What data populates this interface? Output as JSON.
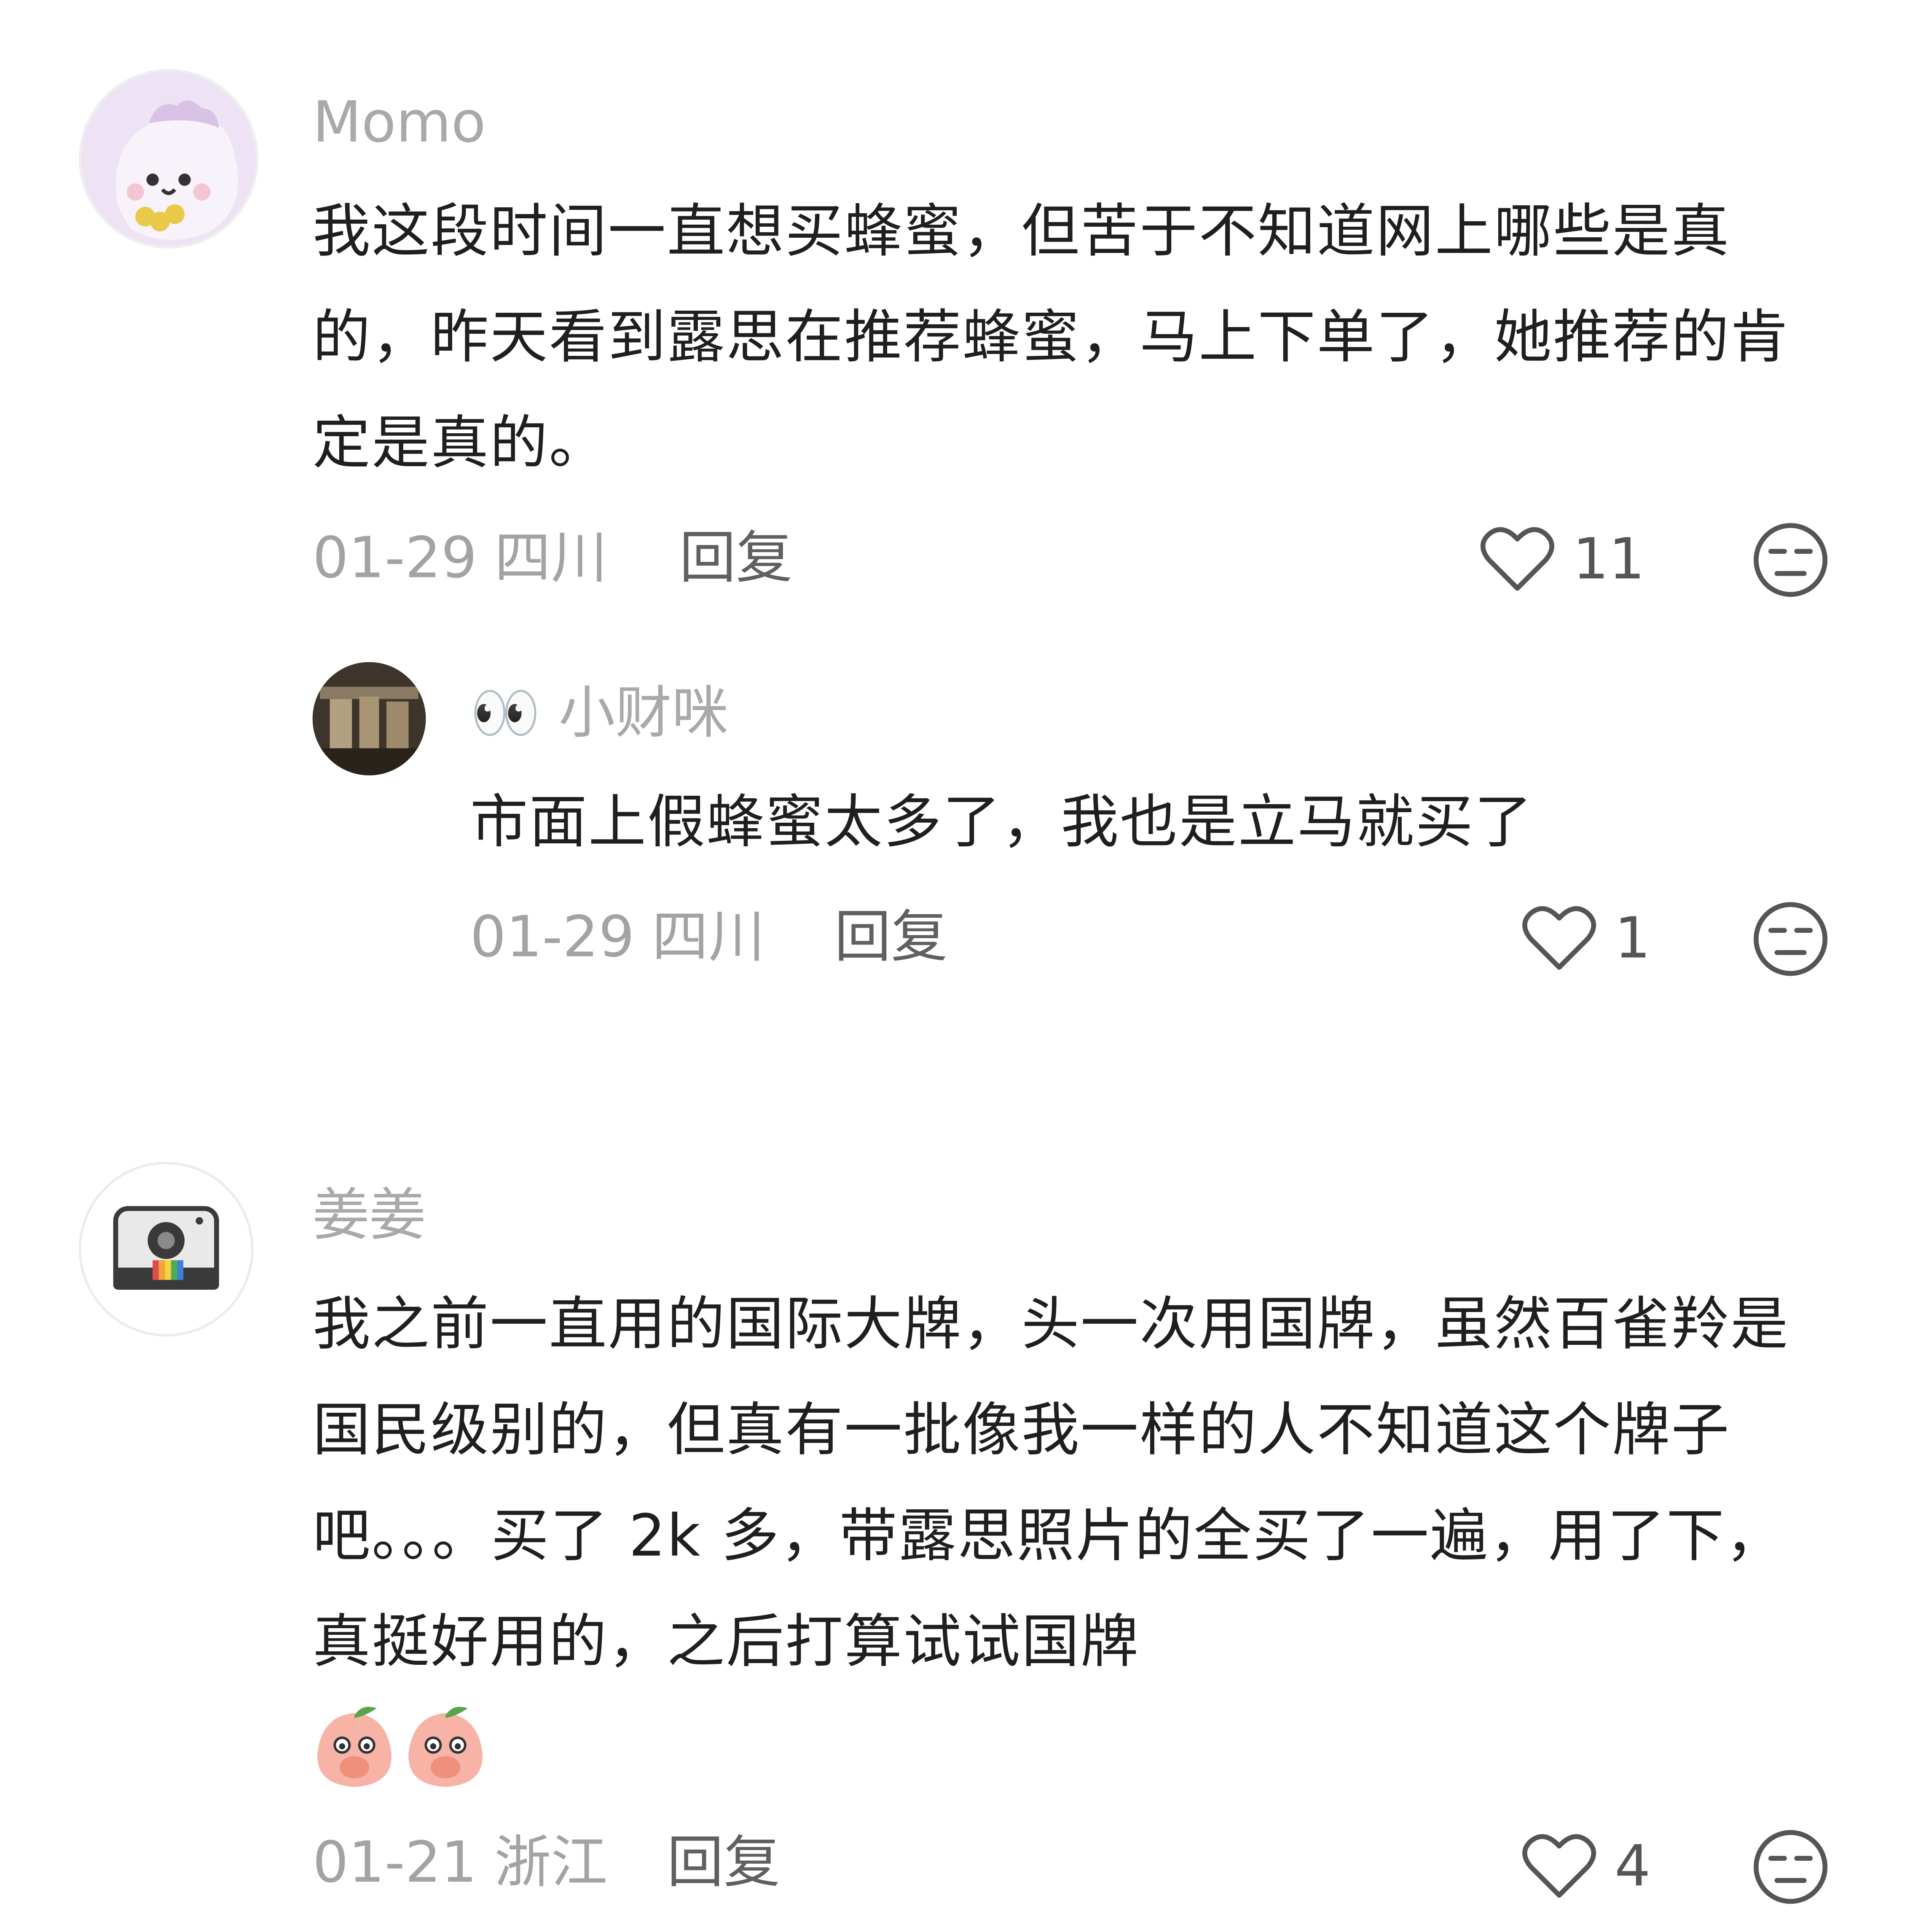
{
  "comments": [
    {
      "user": "Momo",
      "text": "我这段时间一直想买蜂蜜，但苦于不知道网上哪些是真的，昨天看到露思在推荐蜂蜜，马上下单了，她推荐的肯定是真的。",
      "date": "01-29",
      "location": "四川",
      "reply_label": "回复",
      "likes": "11",
      "reply": {
        "user": "👀 小财咪",
        "text": "市面上假蜂蜜太多了，我也是立马就买了",
        "date": "01-29",
        "location": "四川",
        "reply_label": "回复",
        "likes": "1"
      }
    },
    {
      "user": "姜姜",
      "text": "我之前一直用的国际大牌，头一次用国牌，虽然百雀羚是国民级别的，但真有一批像我一样的人不知道这个牌子吧。。。买了 2k 多，带露思照片的全买了一遍，用了下，真挺好用的，之后打算试试国牌",
      "date": "01-21",
      "location": "浙江",
      "reply_label": "回复",
      "likes": "4"
    }
  ],
  "icons": {
    "like": "heart-outline-icon",
    "dislike": "meh-face-icon",
    "emoji": "peach-covering-mouth-emoji"
  },
  "colors": {
    "username": "#a9a9a9",
    "meta": "#a3a3a3",
    "reply": "#606060",
    "text": "#1f1f1f",
    "icon": "#555555"
  }
}
